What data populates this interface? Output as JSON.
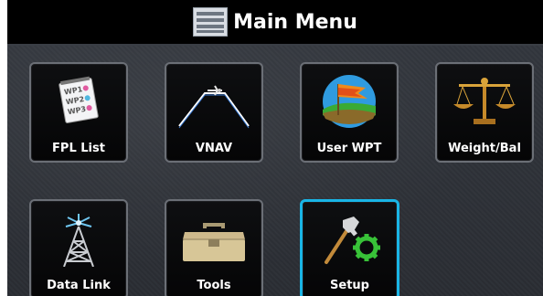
{
  "header": {
    "title": "Main Menu",
    "icon": "list-icon"
  },
  "menu": {
    "tiles": [
      {
        "label": "FPL List",
        "icon": "flight-plan-list-icon",
        "sublabels": [
          "WP1",
          "WP2",
          "WP3"
        ]
      },
      {
        "label": "VNAV",
        "icon": "vnav-profile-icon"
      },
      {
        "label": "User WPT",
        "icon": "user-waypoint-flag-icon"
      },
      {
        "label": "Weight/Bal",
        "icon": "balance-scale-icon"
      },
      {
        "label": "Data Link",
        "icon": "radio-tower-icon"
      },
      {
        "label": "Tools",
        "icon": "toolbox-icon"
      },
      {
        "label": "Setup",
        "icon": "setup-wrench-gear-icon",
        "selected": true
      }
    ]
  },
  "colors": {
    "selection_border": "#19b5e6",
    "tile_border": "#6b6f76",
    "title_bar": "#000000"
  }
}
